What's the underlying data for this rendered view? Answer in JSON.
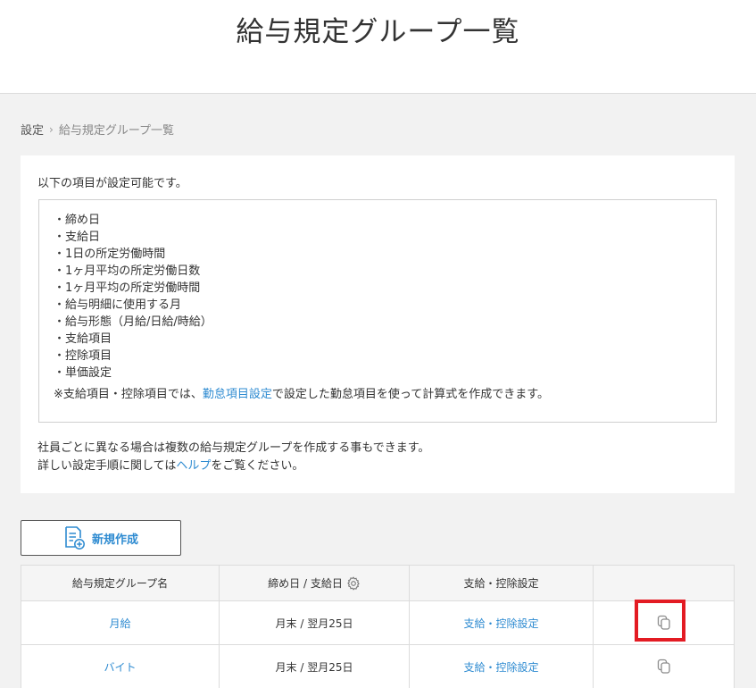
{
  "header": {
    "title": "給与規定グループ一覧"
  },
  "breadcrumb": {
    "parent": "設定",
    "separator": "›",
    "current": "給与規定グループ一覧"
  },
  "info": {
    "intro": "以下の項目が設定可能です。",
    "items": [
      "・締め日",
      "・支給日",
      "・1日の所定労働時間",
      "・1ヶ月平均の所定労働日数",
      "・1ヶ月平均の所定労働時間",
      "・給与明細に使用する月",
      "・給与形態（月給/日給/時給）",
      "・支給項目",
      "・控除項目",
      "・単価設定"
    ],
    "note_prefix": "※支給項目・控除項目では、",
    "note_link": "勤怠項目設定",
    "note_suffix": "で設定した勤怠項目を使って計算式を作成できます。",
    "outro_line1": "社員ごとに異なる場合は複数の給与規定グループを作成する事もできます。",
    "outro_line2_prefix": "詳しい設定手順に関しては",
    "outro_line2_link": "ヘルプ",
    "outro_line2_suffix": "をご覧ください。"
  },
  "toolbar": {
    "new_label": "新規作成",
    "new_icon": "new-document-icon"
  },
  "table": {
    "headers": [
      "給与規定グループ名",
      "締め日 / 支給日",
      "支給・控除設定",
      ""
    ],
    "rows": [
      {
        "name": "月給",
        "dates": "月末 / 翌月25日",
        "settings": "支給・控除設定",
        "action_icon": "copy-icon"
      },
      {
        "name": "バイト",
        "dates": "月末 / 翌月25日",
        "settings": "支給・控除設定",
        "action_icon": "copy-icon"
      }
    ]
  },
  "colors": {
    "link": "#2e8bd1",
    "highlight": "#e31b23",
    "background": "#f2f2f2"
  }
}
